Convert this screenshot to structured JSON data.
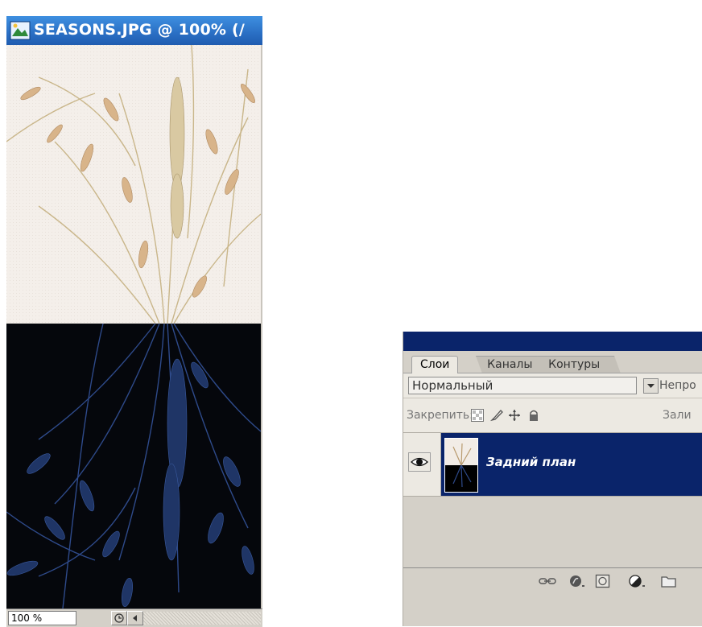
{
  "document": {
    "title": "SEASONS.JPG @ 100% (/",
    "zoom": "100 %",
    "icons": [
      "photoshop-doc-icon",
      "status-arrow-icon",
      "scroll-left-icon"
    ]
  },
  "layers_panel": {
    "tabs": [
      {
        "label": "Слои",
        "active": true
      },
      {
        "label": "Каналы",
        "active": false
      },
      {
        "label": "Контуры",
        "active": false
      }
    ],
    "blend_mode": "Нормальный",
    "opacity_label": "Непро",
    "lock_label": "Закрепить:",
    "fill_label": "Зали",
    "layers": [
      {
        "name": "Задний план",
        "visible": true,
        "selected": true
      }
    ],
    "footer_icons": [
      "link-layers-icon",
      "layer-style-icon",
      "layer-mask-icon",
      "adjustment-layer-icon",
      "new-group-icon"
    ]
  },
  "colors": {
    "title_blue": "#2a6fc4",
    "panel_selection": "#0a246a",
    "panel_gray": "#d4d0c8"
  }
}
